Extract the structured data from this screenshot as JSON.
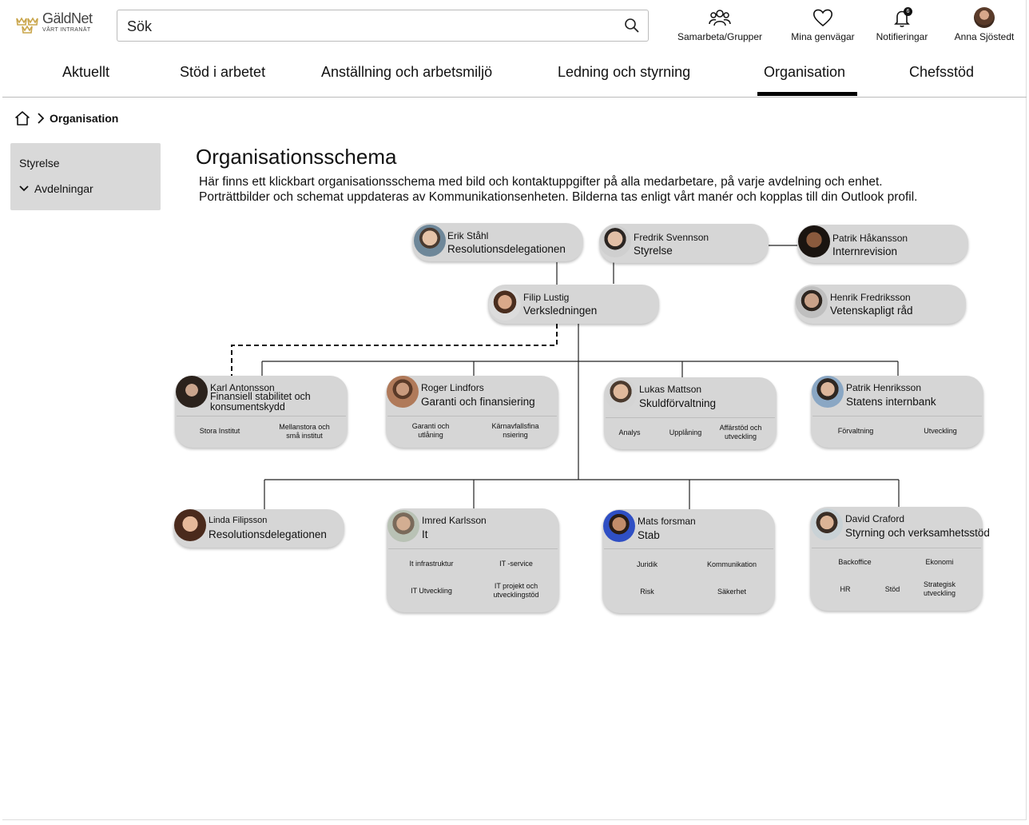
{
  "header": {
    "logo_name": "GäldNet",
    "logo_sub": "VÅRT INTRANÄT",
    "search_placeholder": "Sök",
    "buttons": {
      "samarbeta": "Samarbeta/Grupper",
      "genvagar": "Mina genvägar",
      "notifieringar": "Notifieringar",
      "notif_count": "6",
      "user": "Anna Sjöstedt"
    }
  },
  "nav": {
    "items": [
      "Aktuellt",
      "Stöd i arbetet",
      "Anställning och arbetsmiljö",
      "Ledning och styrning",
      "Organisation",
      "Chefsstöd"
    ],
    "active": "Organisation"
  },
  "breadcrumb": {
    "current": "Organisation"
  },
  "sidebar": {
    "items": [
      "Styrelse",
      "Avdelningar"
    ]
  },
  "main": {
    "title": "Organisationsschema",
    "intro_1": "Här finns ett klickbart organisationsschema med bild och kontaktuppgifter på alla medarbetare, på varje avdelning och enhet.",
    "intro_2": "Porträttbilder och schemat uppdateras av Kommunikationsenheten. Bilderna tas enligt vårt manér och kopplas till din Outlook profil."
  },
  "org": {
    "erik": {
      "name": "Erik Ståhl",
      "unit": "Resolutionsdelegationen"
    },
    "fredrik": {
      "name": "Fredrik Svennson",
      "unit": "Styrelse"
    },
    "patrik_h": {
      "name": "Patrik Håkansson",
      "unit": "Internrevision"
    },
    "filip": {
      "name": "Filip Lustig",
      "unit": "Verksledningen"
    },
    "henrik": {
      "name": "Henrik Fredriksson",
      "unit": "Vetenskapligt råd"
    },
    "karl": {
      "name": "Karl Antonsson",
      "unit": "Finansiell stabilitet och konsumentskydd",
      "subs": [
        "Stora Institut",
        "Mellanstora och små institut"
      ]
    },
    "roger": {
      "name": "Roger Lindfors",
      "unit": "Garanti och finansiering",
      "subs": [
        "Garanti och utlåning",
        "Kärnavfallsfina nsiering"
      ]
    },
    "lukas": {
      "name": "Lukas Mattson",
      "unit": "Skuldförvaltning",
      "subs": [
        "Analys",
        "Upplåning",
        "Affärstöd och utveckling"
      ]
    },
    "patrik_he": {
      "name": "Patrik Henriksson",
      "unit": "Statens internbank",
      "subs": [
        "Förvaltning",
        "Utveckling"
      ]
    },
    "linda": {
      "name": "Linda Filipsson",
      "unit": "Resolutionsdelegationen"
    },
    "imred": {
      "name": "Imred Karlsson",
      "unit": "It",
      "subs": [
        "It infrastruktur",
        "IT -service",
        "IT Utveckling",
        "IT projekt och utvecklingstöd"
      ]
    },
    "mats": {
      "name": "Mats forsman",
      "unit": "Stab",
      "subs": [
        "Juridik",
        "Kommunikation",
        "Risk",
        "Säkerhet"
      ]
    },
    "david": {
      "name": "David Craford",
      "unit": "Styrning och verksamhetsstöd",
      "subs": [
        "Backoffice",
        "Ekonomi",
        "HR",
        "Stöd",
        "Strategisk utveckling"
      ]
    }
  },
  "colors": {
    "card_bg": "#d6d6d6",
    "sidebar_bg": "#d9d9d9",
    "active_underline": "#000000",
    "logo_gold": "#c9a54a"
  }
}
